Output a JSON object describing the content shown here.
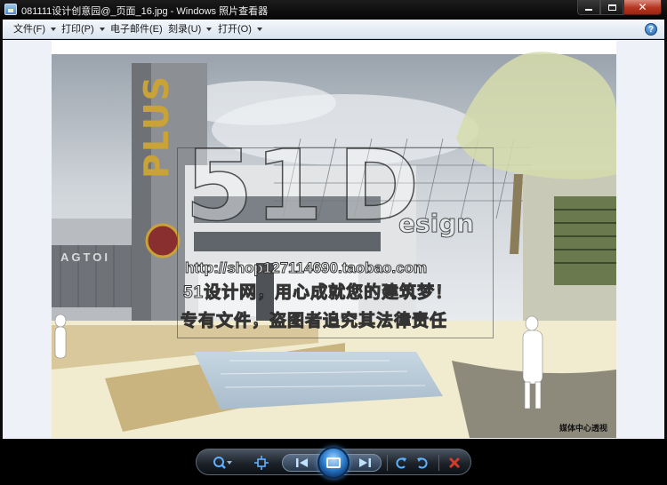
{
  "window": {
    "title": "081111设计创意园@_页面_16.jpg - Windows 照片查看器"
  },
  "menu": {
    "items": [
      {
        "label": "文件(F)"
      },
      {
        "label": "打印(P)"
      },
      {
        "label": "电子邮件(E)"
      },
      {
        "label": "刻录(U)"
      },
      {
        "label": "打开(O)"
      }
    ],
    "help_glyph": "?"
  },
  "image": {
    "caption": "媒体中心透视",
    "sign_text": "PLUS",
    "facade_text": "AGTOI",
    "watermark": {
      "logo_digits": "51",
      "logo_letter": "D",
      "logo_suffix": "esign",
      "url": "http://shop127114690.taobao.com",
      "line_1": "51设计网，用心成就您的建筑梦！",
      "line_2": "专有文件，盗图者追究其法律责任"
    }
  },
  "toolbar": {
    "buttons": [
      "zoom-icon",
      "actual-size-icon",
      "previous-icon",
      "slideshow-icon",
      "next-icon",
      "rotate-counterclockwise-icon",
      "rotate-clockwise-icon",
      "delete-icon"
    ],
    "accent": "#2f7fd0",
    "delete_color": "#d23a2a"
  }
}
